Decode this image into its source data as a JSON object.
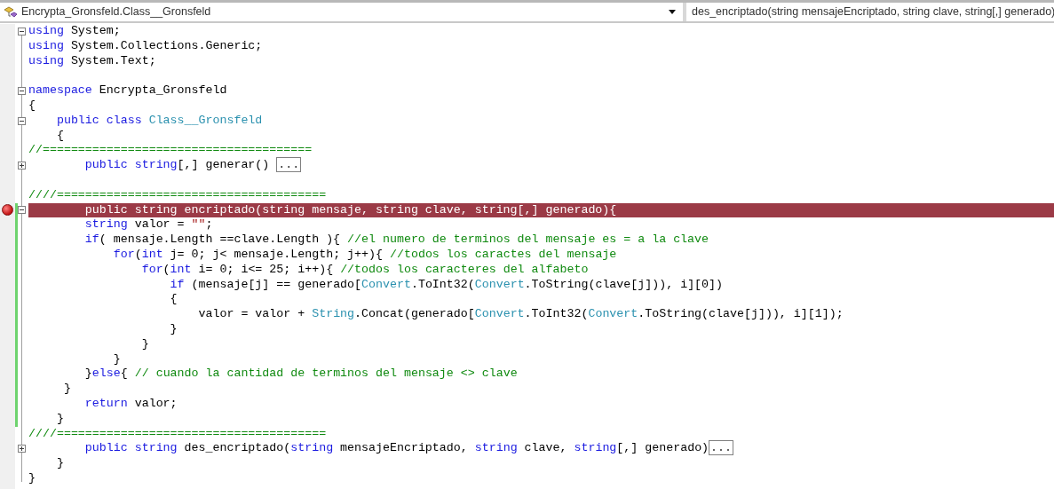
{
  "navigation_bar": {
    "type_dropdown": {
      "text": "Encrypta_Gronsfeld.Class__Gronsfeld"
    },
    "member_dropdown": {
      "text": "des_encriptado(string mensajeEncriptado, string clave, string[,] generado)"
    }
  },
  "editor": {
    "lines": [
      {
        "fold_toggle": {
          "expanded": true
        },
        "segments": [
          {
            "kind": "keyword",
            "text": "using"
          },
          {
            "kind": "plain",
            "text": " System;"
          }
        ]
      },
      {
        "segments": [
          {
            "kind": "keyword",
            "text": "using"
          },
          {
            "kind": "plain",
            "text": " System.Collections.Generic;"
          }
        ]
      },
      {
        "segments": [
          {
            "kind": "keyword",
            "text": "using"
          },
          {
            "kind": "plain",
            "text": " System.Text;"
          }
        ]
      },
      {
        "blank_line_before": true,
        "fold_toggle": {
          "expanded": true
        },
        "segments": [
          {
            "kind": "keyword",
            "text": "namespace"
          },
          {
            "kind": "plain",
            "text": " Encrypta_Gronsfeld"
          }
        ]
      },
      {
        "segments": [
          {
            "kind": "plain",
            "text": "{"
          }
        ]
      },
      {
        "fold_toggle": {
          "expanded": true
        },
        "segments": [
          {
            "kind": "keyword",
            "text": "    public class "
          },
          {
            "kind": "type",
            "text": "Class__Gronsfeld"
          }
        ]
      },
      {
        "segments": [
          {
            "kind": "plain",
            "text": "    {"
          }
        ]
      },
      {
        "segments": [
          {
            "kind": "comment",
            "text": "//======================================"
          }
        ]
      },
      {
        "fold_toggle": {
          "expanded": false
        },
        "segments": [
          {
            "kind": "keyword",
            "text": "        public string"
          },
          {
            "kind": "plain",
            "text": "[,] generar() "
          },
          {
            "kind": "collapsed",
            "text": "..."
          }
        ]
      },
      {
        "blank_line_before": true,
        "segments": [
          {
            "kind": "comment",
            "text": "////======================================"
          }
        ]
      },
      {
        "fold_toggle": {
          "expanded": true
        },
        "breakpoint": true,
        "changed": true,
        "segments": [
          {
            "kind": "plain",
            "text": "        public string encriptado(string mensaje, string clave, string[,] generado){"
          }
        ]
      },
      {
        "changed": true,
        "segments": [
          {
            "kind": "keyword",
            "text": "        string"
          },
          {
            "kind": "plain",
            "text": " valor = "
          },
          {
            "kind": "string",
            "text": "\"\""
          },
          {
            "kind": "plain",
            "text": ";"
          }
        ]
      },
      {
        "changed": true,
        "segments": [
          {
            "kind": "keyword",
            "text": "        if"
          },
          {
            "kind": "plain",
            "text": "( mensaje.Length ==clave.Length ){ "
          },
          {
            "kind": "comment",
            "text": "//el numero de terminos del mensaje es = a la clave"
          }
        ]
      },
      {
        "changed": true,
        "segments": [
          {
            "kind": "keyword",
            "text": "            for"
          },
          {
            "kind": "plain",
            "text": "("
          },
          {
            "kind": "keyword",
            "text": "int"
          },
          {
            "kind": "plain",
            "text": " j= 0; j< mensaje.Length; j++){ "
          },
          {
            "kind": "comment",
            "text": "//todos los caractes del mensaje"
          }
        ]
      },
      {
        "changed": true,
        "segments": [
          {
            "kind": "keyword",
            "text": "                for"
          },
          {
            "kind": "plain",
            "text": "("
          },
          {
            "kind": "keyword",
            "text": "int"
          },
          {
            "kind": "plain",
            "text": " i= 0; i<= 25; i++){ "
          },
          {
            "kind": "comment",
            "text": "//todos los caracteres del alfabeto"
          }
        ]
      },
      {
        "changed": true,
        "segments": [
          {
            "kind": "keyword",
            "text": "                    if"
          },
          {
            "kind": "plain",
            "text": " (mensaje[j] == generado["
          },
          {
            "kind": "type",
            "text": "Convert"
          },
          {
            "kind": "plain",
            "text": ".ToInt32("
          },
          {
            "kind": "type",
            "text": "Convert"
          },
          {
            "kind": "plain",
            "text": ".ToString(clave[j])), i][0])"
          }
        ]
      },
      {
        "changed": true,
        "segments": [
          {
            "kind": "plain",
            "text": "                    {"
          }
        ]
      },
      {
        "changed": true,
        "segments": [
          {
            "kind": "plain",
            "text": "                        valor = valor + "
          },
          {
            "kind": "type",
            "text": "String"
          },
          {
            "kind": "plain",
            "text": ".Concat(generado["
          },
          {
            "kind": "type",
            "text": "Convert"
          },
          {
            "kind": "plain",
            "text": ".ToInt32("
          },
          {
            "kind": "type",
            "text": "Convert"
          },
          {
            "kind": "plain",
            "text": ".ToString(clave[j])), i][1]);"
          }
        ]
      },
      {
        "changed": true,
        "segments": [
          {
            "kind": "plain",
            "text": "                    }"
          }
        ]
      },
      {
        "changed": true,
        "segments": [
          {
            "kind": "plain",
            "text": "                }"
          }
        ]
      },
      {
        "changed": true,
        "segments": [
          {
            "kind": "plain",
            "text": "            }"
          }
        ]
      },
      {
        "changed": true,
        "segments": [
          {
            "kind": "plain",
            "text": "        }"
          },
          {
            "kind": "keyword",
            "text": "else"
          },
          {
            "kind": "plain",
            "text": "{ "
          },
          {
            "kind": "comment",
            "text": "// cuando la cantidad de terminos del mensaje <> clave"
          }
        ]
      },
      {
        "changed": true,
        "segments": [
          {
            "kind": "plain",
            "text": "     }"
          }
        ]
      },
      {
        "changed": true,
        "segments": [
          {
            "kind": "keyword",
            "text": "        return"
          },
          {
            "kind": "plain",
            "text": " valor;"
          }
        ]
      },
      {
        "changed": true,
        "segments": [
          {
            "kind": "plain",
            "text": "    }"
          }
        ]
      },
      {
        "segments": [
          {
            "kind": "comment",
            "text": "////======================================"
          }
        ]
      },
      {
        "fold_toggle": {
          "expanded": false
        },
        "segments": [
          {
            "kind": "keyword",
            "text": "        public string"
          },
          {
            "kind": "plain",
            "text": " des_encriptado("
          },
          {
            "kind": "keyword",
            "text": "string"
          },
          {
            "kind": "plain",
            "text": " mensajeEncriptado, "
          },
          {
            "kind": "keyword",
            "text": "string"
          },
          {
            "kind": "plain",
            "text": " clave, "
          },
          {
            "kind": "keyword",
            "text": "string"
          },
          {
            "kind": "plain",
            "text": "[,] generado)"
          },
          {
            "kind": "collapsed",
            "text": "..."
          }
        ]
      },
      {
        "segments": [
          {
            "kind": "plain",
            "text": "    }"
          }
        ]
      },
      {
        "segments": [
          {
            "kind": "plain",
            "text": "}"
          }
        ]
      }
    ]
  }
}
